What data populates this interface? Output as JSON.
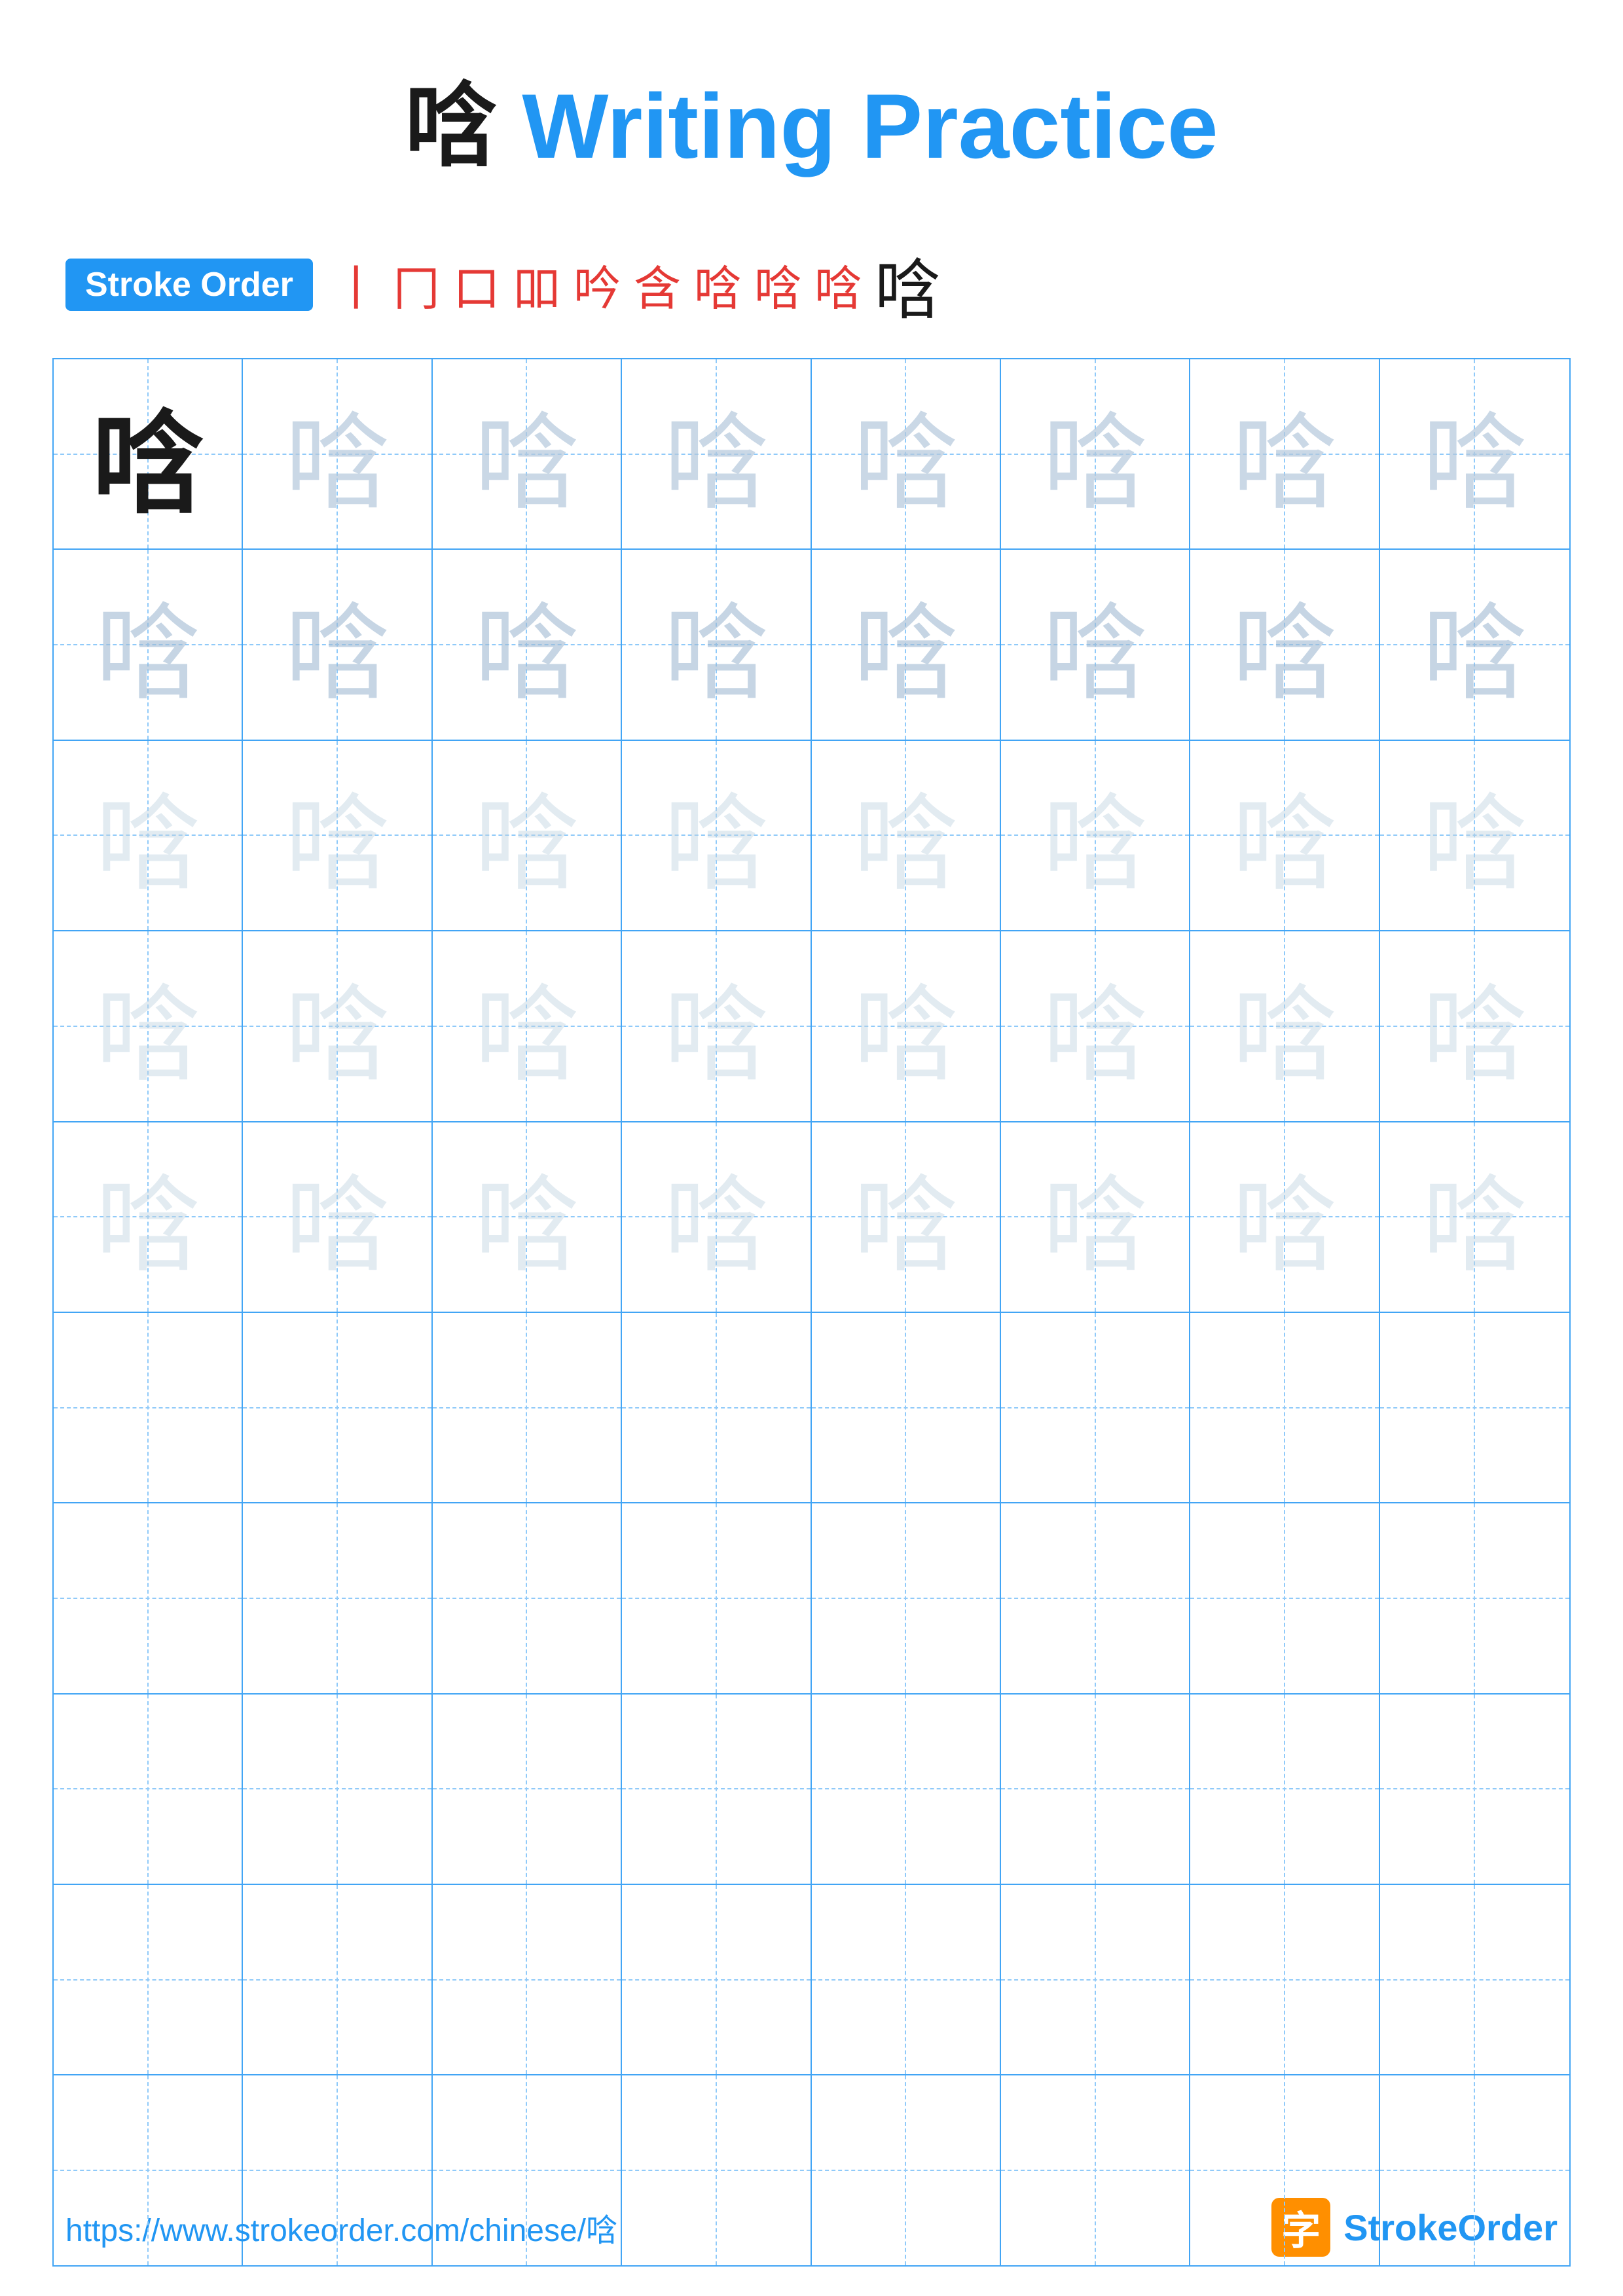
{
  "title": {
    "char": "唅",
    "text": " Writing Practice",
    "full": "唅 Writing Practice"
  },
  "stroke_order": {
    "badge_label": "Stroke Order",
    "strokes": [
      "丨",
      "冂",
      "口",
      "吅",
      "吟",
      "含",
      "唅",
      "唅",
      "唅",
      "唅"
    ]
  },
  "grid": {
    "rows": 10,
    "cols": 8,
    "char": "唅",
    "practice_rows": 5,
    "empty_rows": 5
  },
  "footer": {
    "url": "https://www.strokeorder.com/chinese/唅",
    "brand_char": "字",
    "brand_name_part1": "Stroke",
    "brand_name_part2": "Order"
  }
}
